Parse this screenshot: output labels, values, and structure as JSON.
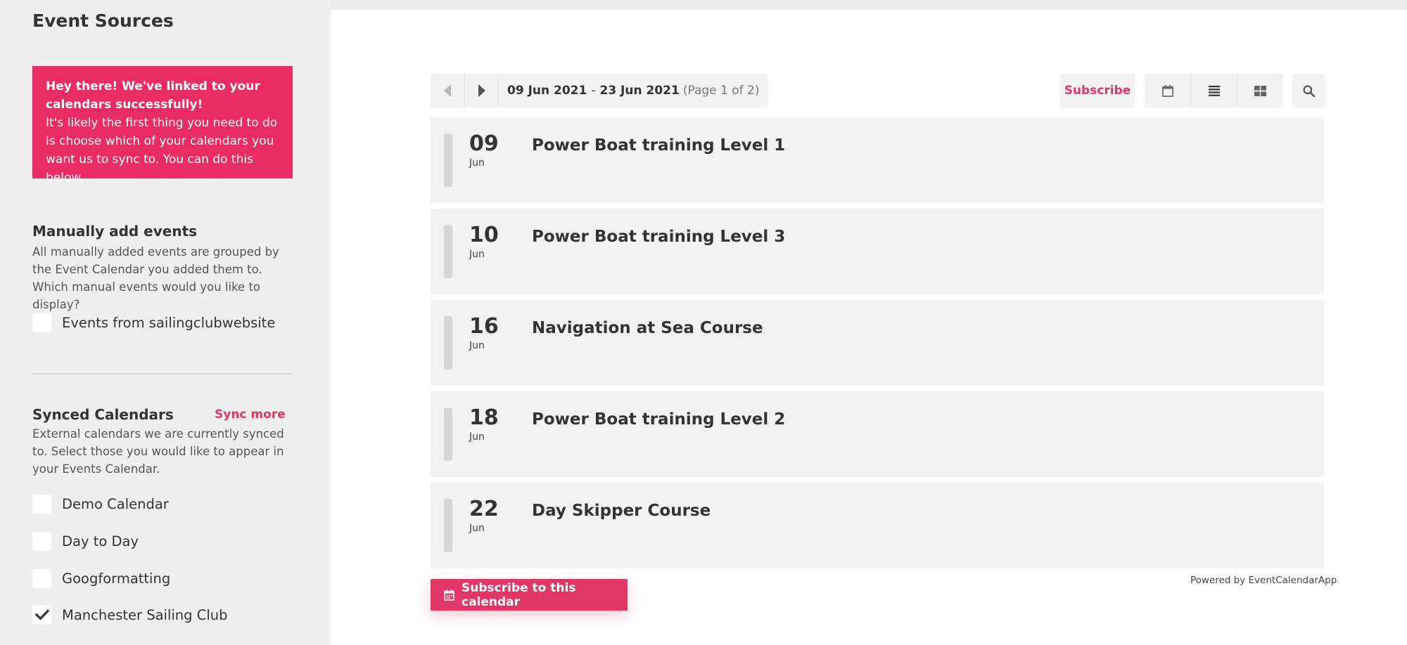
{
  "sidebar": {
    "title": "Event Sources",
    "alert": {
      "heading": "Hey there! We've linked to your calendars successfully!",
      "body": "It's likely the first thing you need to do is choose which of your calendars you want us to sync to. You can do this below."
    },
    "manual": {
      "title": "Manually add events",
      "description": "All manually added events are grouped by the Event Calendar you added them to. Which manual events would you like to display?",
      "items": [
        {
          "label": "Events from sailingclubwebsite",
          "checked": false
        }
      ]
    },
    "synced": {
      "title": "Synced Calendars",
      "sync_more": "Sync more",
      "description": "External calendars we are currently synced to. Select those you would like to appear in your Events Calendar.",
      "items": [
        {
          "label": "Demo Calendar",
          "checked": false
        },
        {
          "label": "Day to Day",
          "checked": false
        },
        {
          "label": "Googformatting",
          "checked": false
        },
        {
          "label": "Manchester Sailing Club",
          "checked": true
        }
      ]
    }
  },
  "main": {
    "toolbar": {
      "range_start": "09 Jun 2021",
      "range_sep": "-",
      "range_end": "23 Jun 2021",
      "page_info": "(Page 1 of 2)",
      "subscribe_label": "Subscribe"
    },
    "events": [
      {
        "day": "09",
        "month": "Jun",
        "title": "Power Boat training Level 1"
      },
      {
        "day": "10",
        "month": "Jun",
        "title": "Power Boat training Level 3"
      },
      {
        "day": "16",
        "month": "Jun",
        "title": "Navigation at Sea Course"
      },
      {
        "day": "18",
        "month": "Jun",
        "title": "Power Boat training Level 2"
      },
      {
        "day": "22",
        "month": "Jun",
        "title": "Day Skipper Course"
      }
    ],
    "powered_by": "Powered by EventCalendarApp",
    "subscribe_calendar_label": "Subscribe to this calendar"
  },
  "colors": {
    "accent": "#e03766",
    "alert_bg": "#e92c64"
  }
}
